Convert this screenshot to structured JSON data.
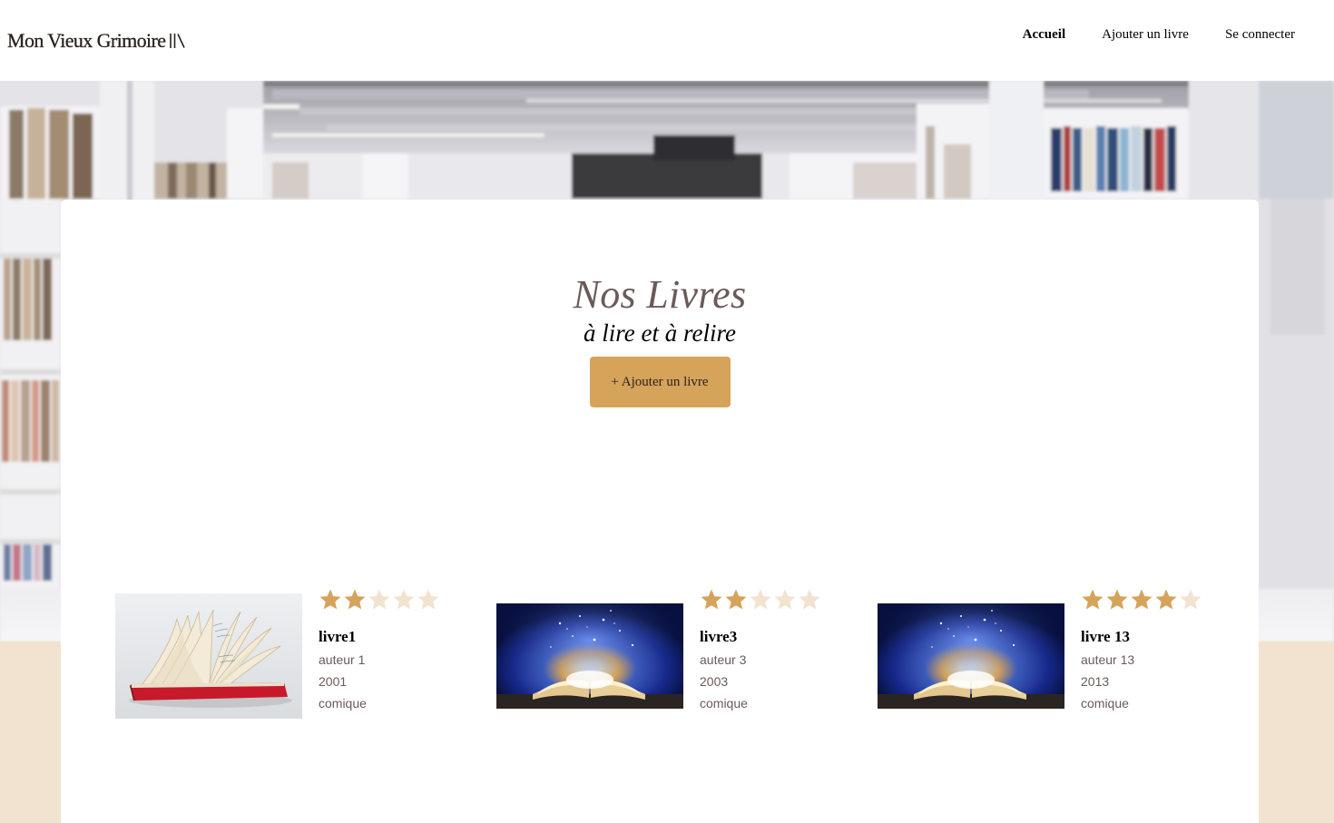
{
  "header": {
    "logo_text": "Mon Vieux Grimoire",
    "nav": [
      {
        "label": "Accueil",
        "active": true
      },
      {
        "label": "Ajouter un livre",
        "active": false
      },
      {
        "label": "Se connecter",
        "active": false
      }
    ]
  },
  "main": {
    "title": "Nos Livres",
    "subtitle": "à lire et à relire",
    "add_button_label": "+ Ajouter un livre"
  },
  "books": [
    {
      "title": "livre1",
      "author": "auteur 1",
      "year": "2001",
      "genre": "comique",
      "rating": 2,
      "cover": "open-book-pages-icon"
    },
    {
      "title": "livre3",
      "author": "auteur 3",
      "year": "2003",
      "genre": "comique",
      "rating": 2,
      "cover": "magic-book-icon"
    },
    {
      "title": "livre 13",
      "author": "auteur 13",
      "year": "2013",
      "genre": "comique",
      "rating": 4,
      "cover": "magic-book-icon"
    }
  ],
  "colors": {
    "accent": "#d6a35b",
    "star_filled": "#d6a35b",
    "star_empty": "#f2e3d0",
    "title": "#6b5a5a",
    "beige": "#f2e3d0"
  }
}
